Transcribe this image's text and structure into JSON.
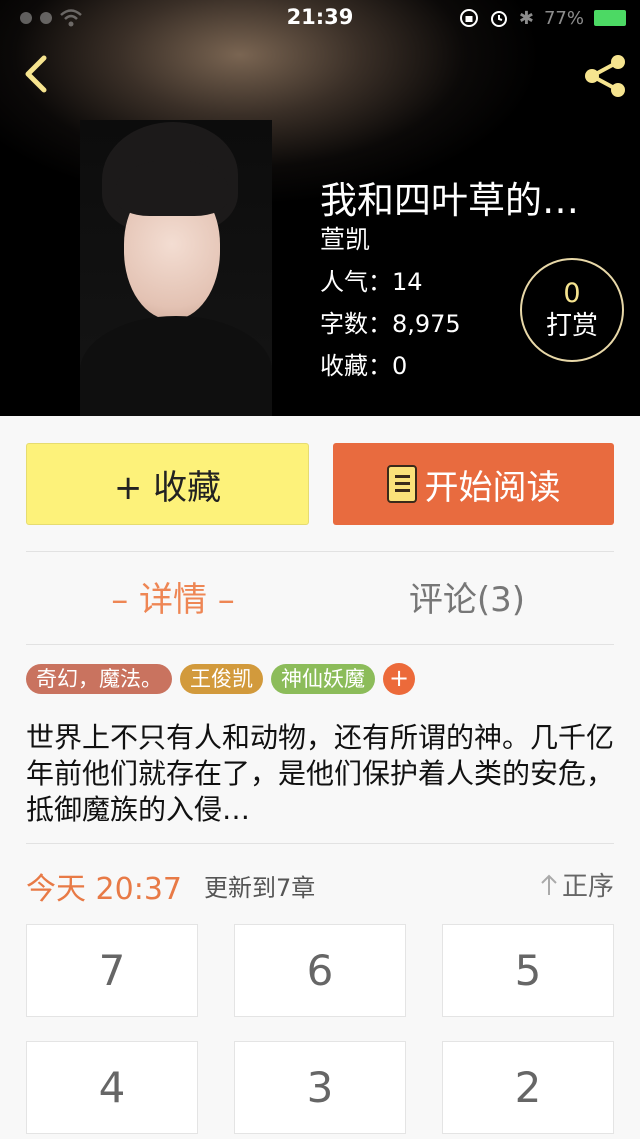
{
  "status_bar": {
    "time": "21:39",
    "battery_text": "77%",
    "icons": [
      "signal-icon",
      "wifi-icon",
      "orientation-lock-icon",
      "alarm-icon",
      "bluetooth-icon",
      "battery-icon"
    ]
  },
  "nav": {
    "back_icon": "chevron-left-icon",
    "share_icon": "share-icon",
    "icon_color": "#f6e48f"
  },
  "book": {
    "title": "我和四叶草的…",
    "author": "萱凯",
    "popularity": "人气：14",
    "word_count": "字数：8,975",
    "favorites": "收藏：0"
  },
  "tip": {
    "count": "0",
    "label": "打赏"
  },
  "actions": {
    "collect_label": "+ 收藏",
    "read_label": "开始阅读",
    "collect_color": "#fdf27a",
    "read_color": "#e86b3f"
  },
  "tabs": {
    "detail": "– 详情 –",
    "comments": "评论(3)",
    "active_color": "#ee8654"
  },
  "tags": [
    {
      "label": "奇幻，魔法。",
      "color": "#c9735f"
    },
    {
      "label": "王俊凯",
      "color": "#d29a3c"
    },
    {
      "label": "神仙妖魔",
      "color": "#8cbc5a"
    }
  ],
  "tag_add_label": "+",
  "synopsis": "世界上不只有人和动物，还有所谓的神。几千亿年前他们就存在了，是他们保护着人类的安危，抵御魔族的入侵…",
  "update": {
    "time": "今天 20:37",
    "text": "更新到7章",
    "order_label": "正序"
  },
  "chapters": [
    "7",
    "6",
    "5",
    "4",
    "3",
    "2"
  ]
}
